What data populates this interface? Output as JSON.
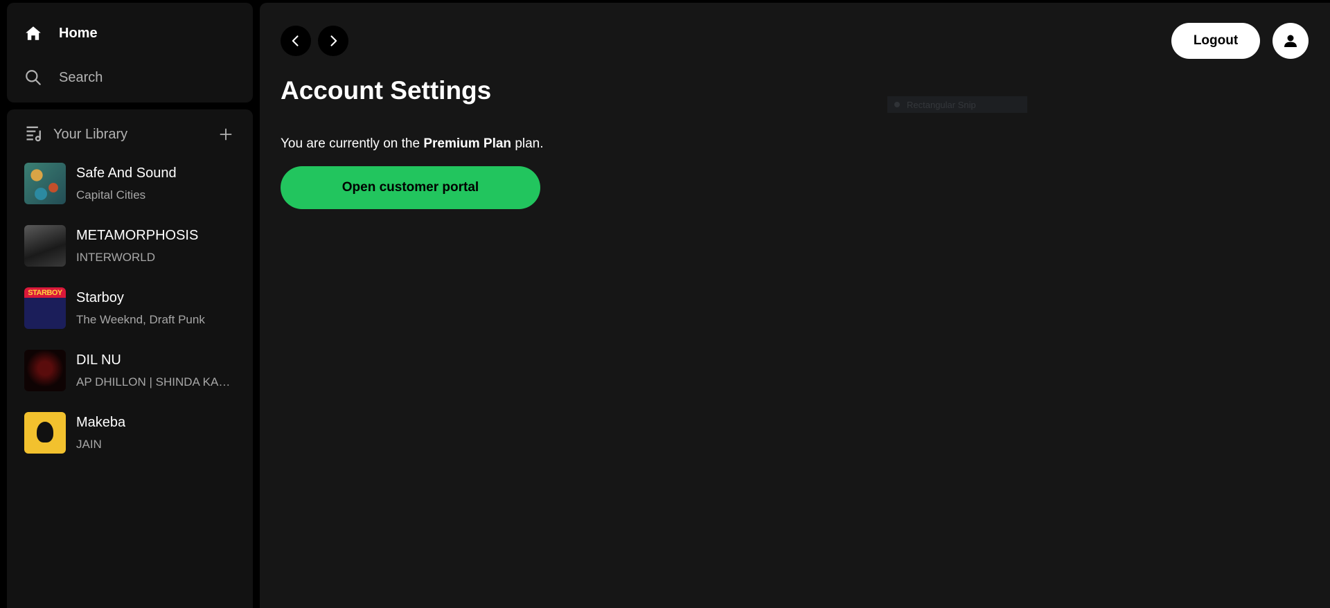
{
  "sidebar": {
    "nav": [
      {
        "label": "Home",
        "icon": "home-icon"
      },
      {
        "label": "Search",
        "icon": "search-icon"
      }
    ],
    "library": {
      "title": "Your Library",
      "icon": "library-icon",
      "add_icon": "plus-icon",
      "items": [
        {
          "title": "Safe And Sound",
          "artist": "Capital Cities"
        },
        {
          "title": "METAMORPHOSIS",
          "artist": "INTERWORLD"
        },
        {
          "title": "Starboy",
          "artist": "The Weeknd, Draft Punk",
          "cover_text": "STARBOY"
        },
        {
          "title": "DIL NU",
          "artist": "AP DHILLON | SHINDA KAHLON"
        },
        {
          "title": "Makeba",
          "artist": "JAIN"
        }
      ]
    }
  },
  "header": {
    "back_icon": "chevron-left-icon",
    "forward_icon": "chevron-right-icon",
    "logout_label": "Logout",
    "user_icon": "user-icon"
  },
  "main": {
    "title": "Account Settings",
    "plan_prefix": "You are currently on the ",
    "plan_name": "Premium Plan",
    "plan_suffix": " plan.",
    "portal_button": "Open customer portal"
  },
  "overlay": {
    "snip_label": "Rectangular Snip"
  },
  "colors": {
    "accent": "#22c55e",
    "panel": "#121212",
    "main_bg": "#161616",
    "muted_text": "#a7a7a7"
  }
}
